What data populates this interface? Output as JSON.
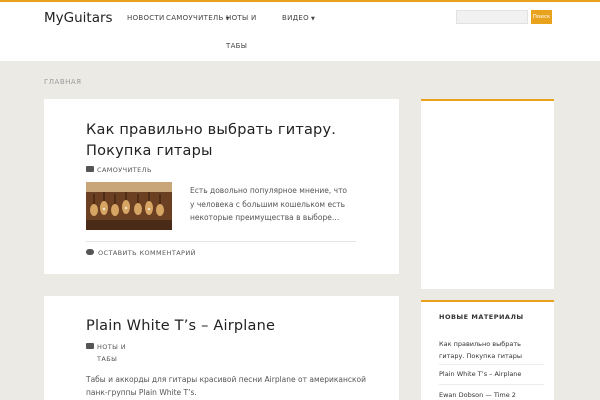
{
  "site": {
    "brand": "MyGuitars"
  },
  "nav": {
    "news": "НОВОСТИ",
    "tutorial": "САМОУЧИТЕЛЬ",
    "notes": "НОТЫ И",
    "tabs": "ТАБЫ",
    "video": "ВИДЕО"
  },
  "search": {
    "placeholder": "",
    "button": "Поиск"
  },
  "breadcrumb": "ГЛАВНАЯ",
  "posts": [
    {
      "title_line1": "Как правильно выбрать гитару.",
      "title_line2": "Покупка гитары",
      "category": "САМОУЧИТЕЛЬ",
      "excerpt": "Есть довольно популярное мнение, что у человека с большим кошельком есть некоторые преимущества в выборе…",
      "comment_link": "ОСТАВИТЬ КОММЕНТАРИЙ"
    },
    {
      "title": "Plain White T’s – Airplane",
      "category_line1": "НОТЫ И",
      "category_line2": "ТАБЫ",
      "excerpt": "Табы и аккорды для гитары красивой песни Airplane от американской панк-группы Plain White T’s."
    }
  ],
  "sidebar": {
    "recent_title": "НОВЫЕ МАТЕРИАЛЫ",
    "recent": [
      "Как правильно выбрать гитару. Покупка гитары",
      "Plain White T’s – Airplane",
      "Ewan Dobson — Time 2"
    ]
  },
  "colors": {
    "accent": "#e9a21b",
    "background": "#eceae5"
  },
  "icons": {
    "category": "folder-icon",
    "comment": "comment-icon",
    "dropdown": "caret-down-icon"
  }
}
